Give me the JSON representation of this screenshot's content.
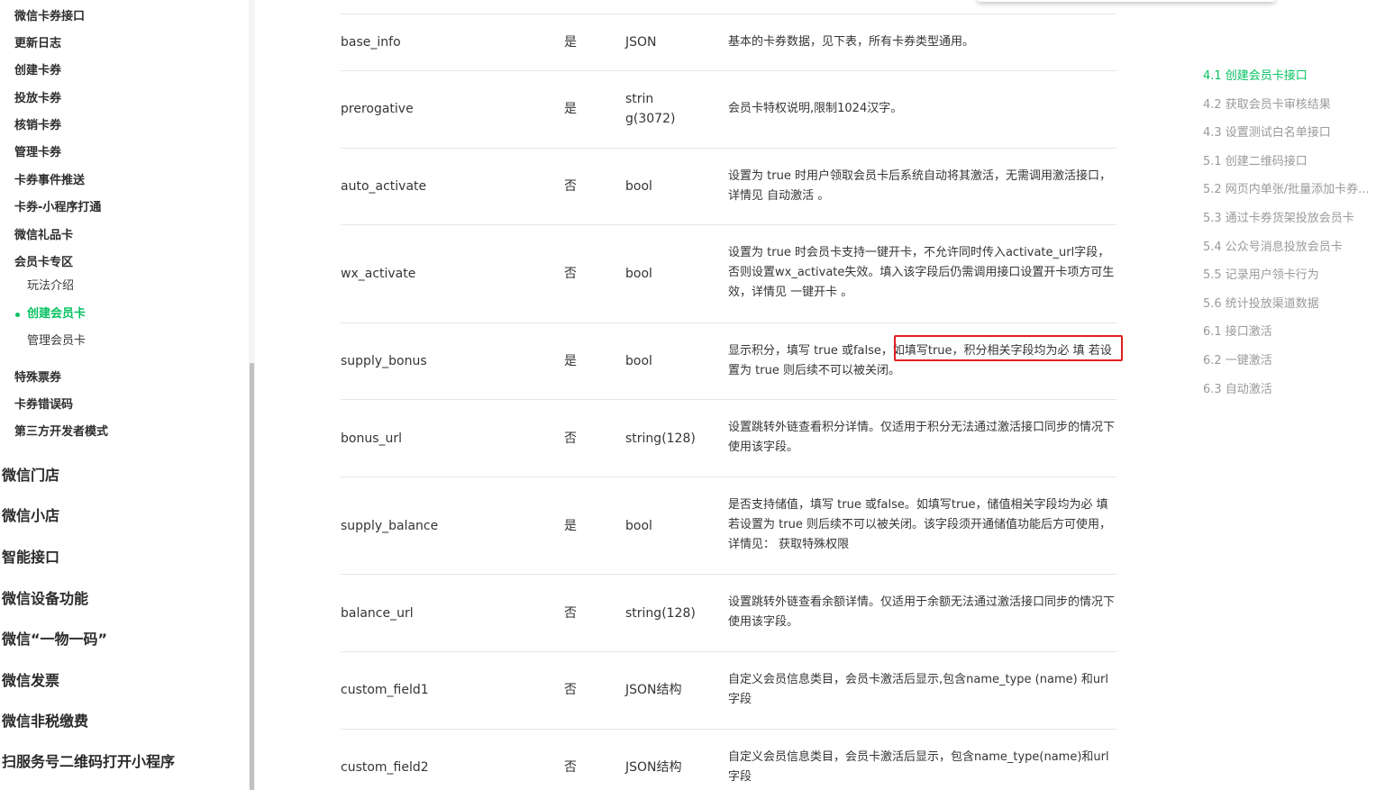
{
  "sidebar": {
    "items": [
      {
        "label": "微信卡券接口"
      },
      {
        "label": "更新日志"
      },
      {
        "label": "创建卡券"
      },
      {
        "label": "投放卡券"
      },
      {
        "label": "核销卡券"
      },
      {
        "label": "管理卡券"
      },
      {
        "label": "卡券事件推送"
      },
      {
        "label": "卡券-小程序打通"
      },
      {
        "label": "微信礼品卡"
      },
      {
        "label": "会员卡专区"
      }
    ],
    "sub_items": [
      {
        "label": "玩法介绍"
      },
      {
        "label": "创建会员卡"
      },
      {
        "label": "管理会员卡"
      }
    ],
    "items_after": [
      {
        "label": "特殊票券"
      },
      {
        "label": "卡券错误码"
      },
      {
        "label": "第三方开发者模式"
      }
    ],
    "top_level": [
      {
        "label": "微信门店"
      },
      {
        "label": "微信小店"
      },
      {
        "label": "智能接口"
      },
      {
        "label": "微信设备功能"
      },
      {
        "label": "微信“一物一码”"
      },
      {
        "label": "微信发票"
      },
      {
        "label": "微信非税缴费"
      },
      {
        "label": "扫服务号二维码打开小程序"
      }
    ]
  },
  "table": {
    "rows": [
      {
        "name": "base_info",
        "required": "是",
        "type": "JSON",
        "desc": "基本的卡券数据，见下表，所有卡券类型通用。"
      },
      {
        "name": "prerogative",
        "required": "是",
        "type": "strin g(3072)",
        "desc": "会员卡特权说明,限制1024汉字。"
      },
      {
        "name": "auto_activate",
        "required": "否",
        "type": "bool",
        "desc": "设置为 true 时用户领取会员卡后系统自动将其激活，无需调用激活接口，详情见 自动激活 。"
      },
      {
        "name": "wx_activate",
        "required": "否",
        "type": "bool",
        "desc": "设置为 true 时会员卡支持一键开卡，不允许同时传入activate_url字段，否则设置wx_activate失效。填入该字段后仍需调用接口设置开卡项方可生效，详情见 一键开卡 。"
      },
      {
        "name": "supply_bonus",
        "required": "是",
        "type": "bool",
        "desc": "显示积分，填写 true 或false，如填写true，积分相关字段均为必 填 若设置为 true 则后续不可以被关闭。"
      },
      {
        "name": "bonus_url",
        "required": "否",
        "type": "string(128)",
        "desc": "设置跳转外链查看积分详情。仅适用于积分无法通过激活接口同步的情况下使用该字段。"
      },
      {
        "name": "supply_balance",
        "required": "是",
        "type": "bool",
        "desc": "是否支持储值，填写 true 或false。如填写true，储值相关字段均为必 填 若设置为 true 则后续不可以被关闭。该字段须开通储值功能后方可使用， 详情见： 获取特殊权限"
      },
      {
        "name": "balance_url",
        "required": "否",
        "type": "string(128)",
        "desc": "设置跳转外链查看余额详情。仅适用于余额无法通过激活接口同步的情况下使用该字段。"
      },
      {
        "name": "custom_field1",
        "required": "否",
        "type": "JSON结构",
        "desc": "自定义会员信息类目，会员卡激活后显示,包含name_type (name) 和url 字段"
      },
      {
        "name": "custom_field2",
        "required": "否",
        "type": "JSON结构",
        "desc": "自定义会员信息类目，会员卡激活后显示，包含name_type(name)和url 字段"
      }
    ]
  },
  "toc": {
    "items": [
      {
        "label": "4.1 创建会员卡接口",
        "active": true
      },
      {
        "label": "4.2 获取会员卡审核结果"
      },
      {
        "label": "4.3 设置测试白名单接口"
      },
      {
        "label": "5.1 创建二维码接口"
      },
      {
        "label": "5.2 网页内单张/批量添加卡券..."
      },
      {
        "label": "5.3 通过卡券货架投放会员卡"
      },
      {
        "label": "5.4 公众号消息投放会员卡"
      },
      {
        "label": "5.5 记录用户领卡行为"
      },
      {
        "label": "5.6 统计投放渠道数据"
      },
      {
        "label": "6.1 接口激活"
      },
      {
        "label": "6.2 一键激活"
      },
      {
        "label": "6.3 自动激活"
      }
    ]
  },
  "colors": {
    "accent": "#07c160",
    "highlight_border": "#e02020"
  }
}
